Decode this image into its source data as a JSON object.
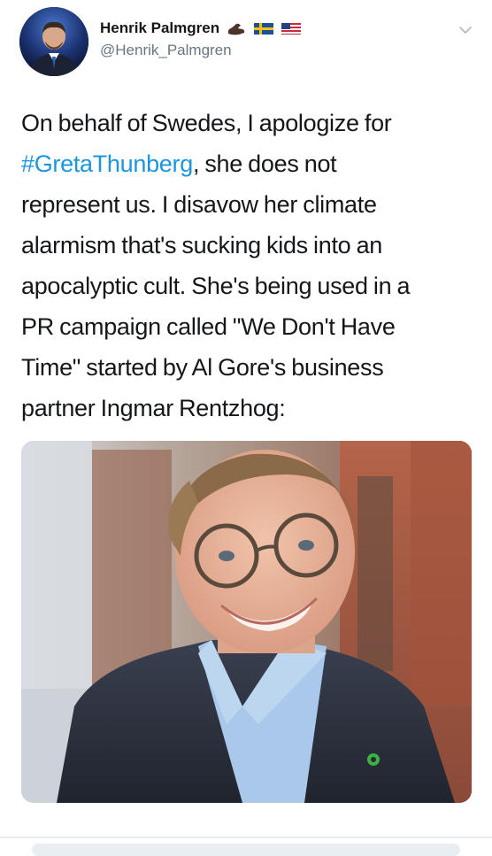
{
  "tweet": {
    "author": {
      "display_name": "Henrik Palmgren",
      "handle": "@Henrik_Palmgren",
      "name_emojis": [
        "flexed-arm-icon",
        "swedish-flag-icon",
        "us-flag-icon"
      ]
    },
    "text_lines": [
      "On behalf of Swedes, I apologize for",
      ", she does not",
      "represent us. I disavow her climate",
      "alarmism that's sucking kids into an",
      "apocalyptic cult. She's being used in a",
      "PR campaign called \"We Don't Have",
      "Time\" started by Al Gore's business",
      "partner Ingmar Rentzhog:"
    ],
    "hashtag": "#GretaThunberg",
    "colors": {
      "hashtag": "#1b95e0",
      "handle": "#657786",
      "text": "#14171a"
    }
  }
}
